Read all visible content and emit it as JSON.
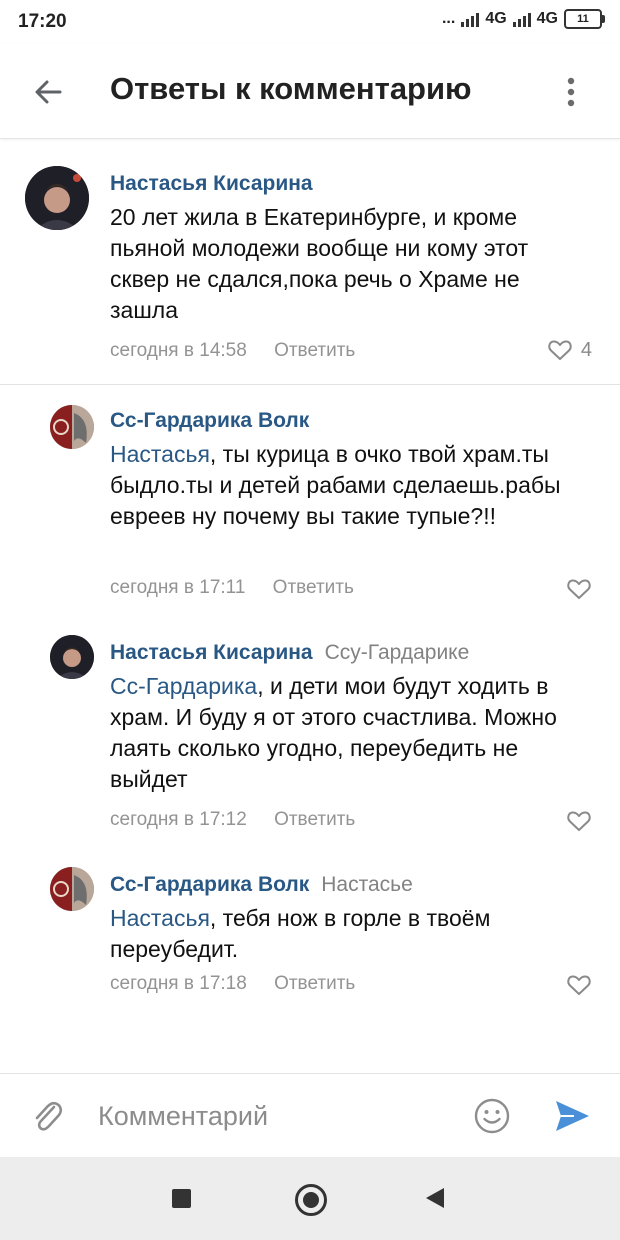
{
  "status_bar": {
    "time": "17:20",
    "dots": "...",
    "net1": "4G",
    "net2": "4G",
    "battery": "11"
  },
  "header": {
    "title": "Ответы к комментарию",
    "back_icon": "arrow-left-icon",
    "more_icon": "more-vertical-icon"
  },
  "comments": [
    {
      "author": "Настасья Кисарина",
      "reply_to": "",
      "mention": "",
      "text": "20 лет жила в Екатеринбурге, и кроме пьяной молодежи вообще ни кому этот сквер не сдался,пока речь о Храме не зашла",
      "time": "сегодня в 14:58",
      "reply_label": "Ответить",
      "likes": "4"
    },
    {
      "author": "Сс-Гардарика Волк",
      "reply_to": "",
      "mention": "Настасья",
      "text": ", ты курица в очко твой храм.ты быдло.ты и детей рабами сделаешь.рабы евреев ну почему вы такие тупые?!!",
      "time": "сегодня в 17:11",
      "reply_label": "Ответить",
      "likes": ""
    },
    {
      "author": "Настасья Кисарина",
      "reply_to": "Ссу-Гардарике",
      "mention": "Сс-Гардарика",
      "text": ", и дети мои будут ходить в храм. И буду я от этого счастлива. Можно лаять сколько угодно, переубедить не выйдет",
      "time": "сегодня в 17:12",
      "reply_label": "Ответить",
      "likes": ""
    },
    {
      "author": "Сс-Гардарика Волк",
      "reply_to": "Настасье",
      "mention": "Настасья",
      "text": ", тебя нож в горле в твоём переубедит.",
      "time": "сегодня в 17:18",
      "reply_label": "Ответить",
      "likes": ""
    }
  ],
  "composer": {
    "placeholder": "Комментарий",
    "attach_icon": "paperclip-icon",
    "emoji_icon": "emoji-icon",
    "send_icon": "send-icon"
  },
  "colors": {
    "link": "#2a5885",
    "send": "#4a90d9",
    "meta": "#939393"
  }
}
